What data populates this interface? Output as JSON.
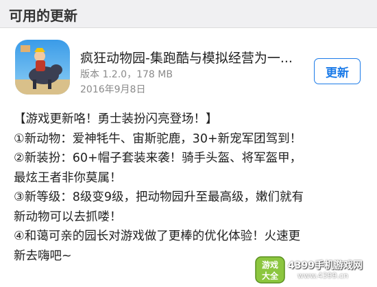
{
  "header": {
    "title": "可用的更新"
  },
  "app": {
    "name": "疯狂动物园-集跑酷与模拟经营为一...",
    "meta": "版本 1.2.0，178 MB",
    "date": "2016年9月8日",
    "update_label": "更新",
    "icon": "crazy-zoo-app-icon"
  },
  "notes": {
    "lines": [
      "【游戏更新咯！勇士装扮闪亮登场！】",
      "①新动物：爱神牦牛、宙斯驼鹿，30+新宠军团驾到！",
      "②新装扮：60+帽子套装来袭！骑手头盔、将军盔甲，",
      "最炫王者非你莫属！",
      "③新等级：8级变9级，把动物园升至最高级，嫩们就有",
      "新动物可以去抓喽！",
      "④和蔼可亲的园长对游戏做了更棒的优化体验！火速更",
      "新去嗨吧~"
    ]
  },
  "watermark": {
    "badge_top": "游戏",
    "badge_bottom": "大全",
    "main": "4399手机游戏网",
    "url": "www.4399.cn"
  },
  "colors": {
    "accent": "#1a7ae8",
    "header_bg": "#f0f0f2"
  }
}
